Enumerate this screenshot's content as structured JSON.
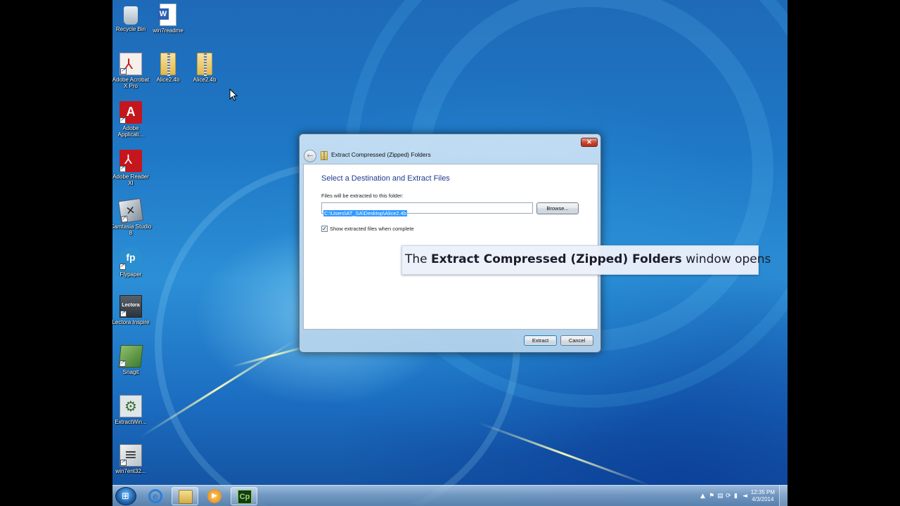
{
  "desktop_icons": [
    {
      "label": "Recycle Bin",
      "icon": "recycle-bin-icon"
    },
    {
      "label": "win7readme",
      "icon": "word-document-icon"
    },
    {
      "label": "Adobe Acrobat X Pro",
      "icon": "acrobat-icon"
    },
    {
      "label": "Alice2.4b",
      "icon": "zip-folder-icon"
    },
    {
      "label": "Alice2.4b",
      "icon": "zip-folder-icon"
    },
    {
      "label": "Adobe Applicati...",
      "icon": "adobe-application-manager-icon"
    },
    {
      "label": "Adobe Reader XI",
      "icon": "adobe-reader-icon"
    },
    {
      "label": "Camtasia Studio 8",
      "icon": "camtasia-icon"
    },
    {
      "label": "Flypaper",
      "icon": "flypaper-icon"
    },
    {
      "label": "Lectora Inspire",
      "icon": "lectora-icon"
    },
    {
      "label": "Snagit",
      "icon": "snagit-icon"
    },
    {
      "label": "ExtractWin...",
      "icon": "extract-installer-icon"
    },
    {
      "label": "win7ent32...",
      "icon": "archive-icon"
    }
  ],
  "dialog": {
    "title": "Extract Compressed (Zipped) Folders",
    "close_label": "✕",
    "heading": "Select a Destination and Extract Files",
    "path_label": "Files will be extracted to this folder:",
    "path_value": "C:\\Users\\AT_SA\\Desktop\\Alice2.4b",
    "browse_label": "Browse...",
    "show_files_label": "Show extracted files when complete",
    "show_files_checked": true,
    "extract_label": "Extract",
    "cancel_label": "Cancel"
  },
  "callout": {
    "prefix": "The ",
    "bold": "Extract Compressed (Zipped) Folders",
    "suffix": " window opens"
  },
  "taskbar": {
    "apps": [
      {
        "name": "Internet Explorer",
        "icon": "internet-explorer-icon",
        "glyph": "e"
      },
      {
        "name": "Windows Explorer",
        "icon": "windows-explorer-icon",
        "glyph": ""
      },
      {
        "name": "Windows Media Player",
        "icon": "media-player-icon",
        "glyph": "▶"
      },
      {
        "name": "Adobe Captivate",
        "icon": "captivate-icon",
        "glyph": "Cp"
      }
    ],
    "time": "12:35 PM",
    "date": "4/3/2014"
  },
  "colors": {
    "desktop_blue": "#1f78c6",
    "heading_blue": "#1e3b8c",
    "selection_blue": "#3399ff"
  }
}
